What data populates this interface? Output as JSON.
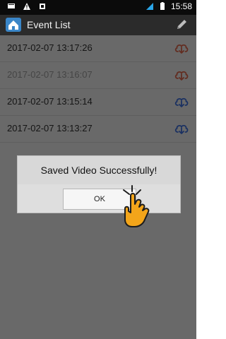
{
  "status": {
    "time": "15:58"
  },
  "appbar": {
    "title": "Event List"
  },
  "events": [
    {
      "timestamp": "2017-02-07 13:17:26",
      "icon": "cloud-download-icon",
      "icon_color": "#d9644a"
    },
    {
      "timestamp": "2017-02-07 13:16:07",
      "icon": "cloud-download-icon",
      "icon_color": "#d9644a",
      "muted": true
    },
    {
      "timestamp": "2017-02-07 13:15:14",
      "icon": "cloud-download-icon",
      "icon_color": "#3d6dd8"
    },
    {
      "timestamp": "2017-02-07 13:13:27",
      "icon": "cloud-download-icon",
      "icon_color": "#3d6dd8"
    }
  ],
  "dialog": {
    "message": "Saved Video Successfully!",
    "ok_label": "OK"
  },
  "colors": {
    "statusbar_bg": "#0b0b0b",
    "appbar_bg": "#2b2b2b",
    "list_bg": "#e9e9e9"
  }
}
